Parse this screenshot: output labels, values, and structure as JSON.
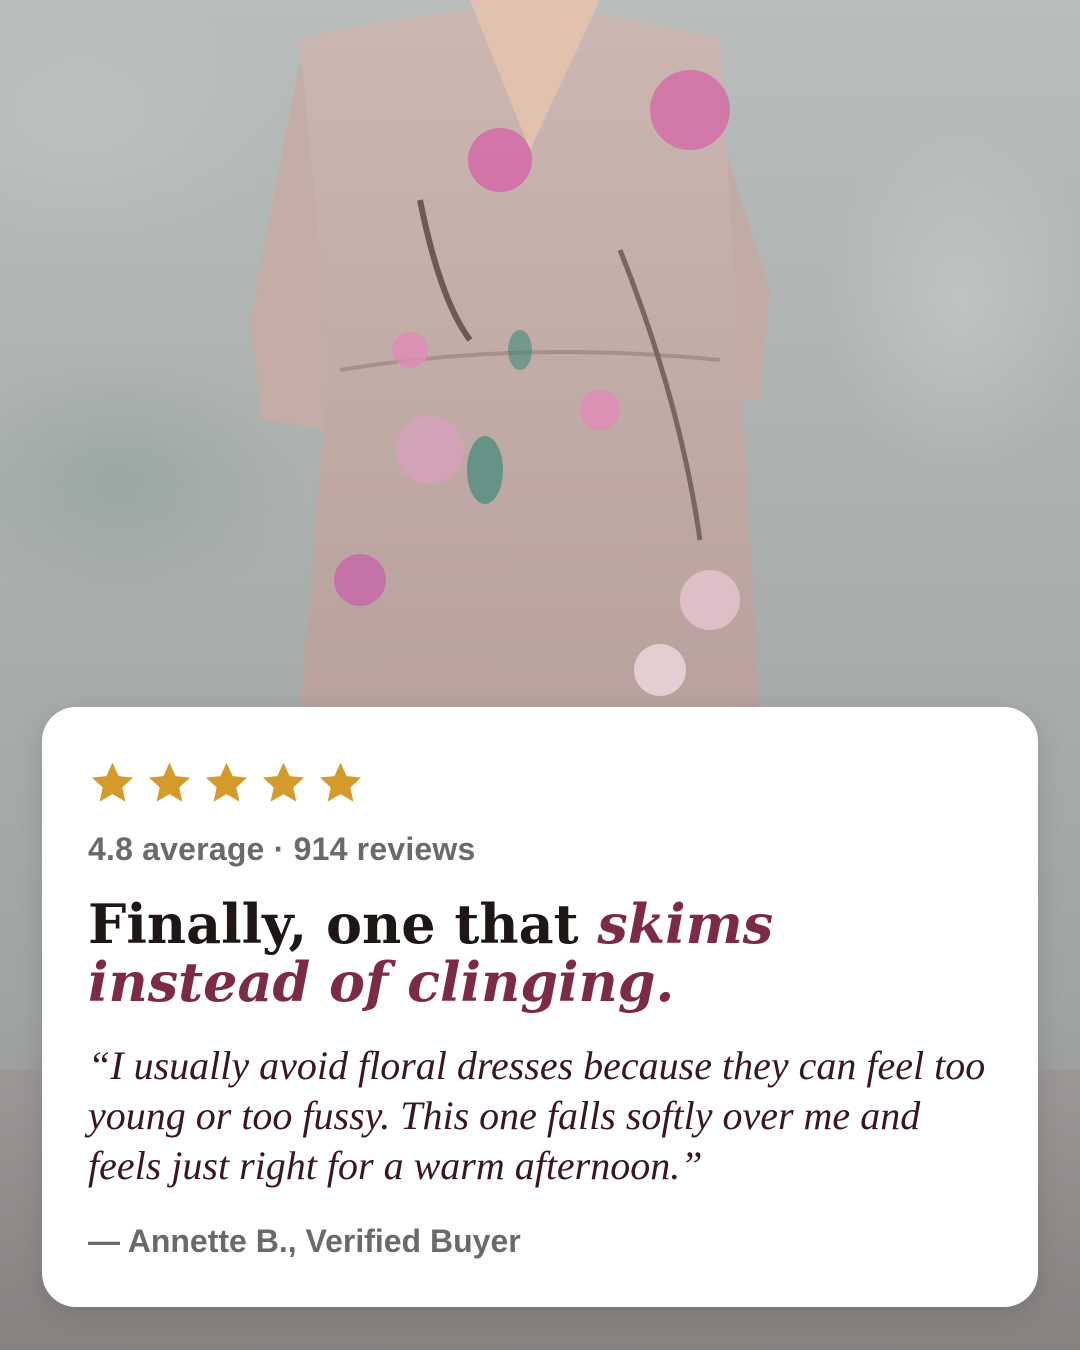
{
  "background": {
    "description_icon": "product-photo-floral-dress",
    "colors": {
      "wall": "#b3b8b6",
      "dress": "#c9b2ad",
      "flower": "#d36aa8",
      "leaf": "#3f8a7a"
    }
  },
  "review_card": {
    "stars": {
      "count": 5,
      "color": "#d49a2a",
      "icon": "star-icon"
    },
    "rating_text": "4.8 average · 914 reviews",
    "headline_plain": "Finally, one that ",
    "headline_accent": "skims instead of clinging.",
    "quote": "“I usually avoid floral dresses because they can feel too young or too fussy. This one falls softly over me and feels just right for a warm afternoon.”",
    "attribution": "— Annette B., Verified Buyer",
    "colors": {
      "accent": "#7d2a45",
      "muted": "#6b6a68",
      "card": "#ffffff"
    }
  }
}
